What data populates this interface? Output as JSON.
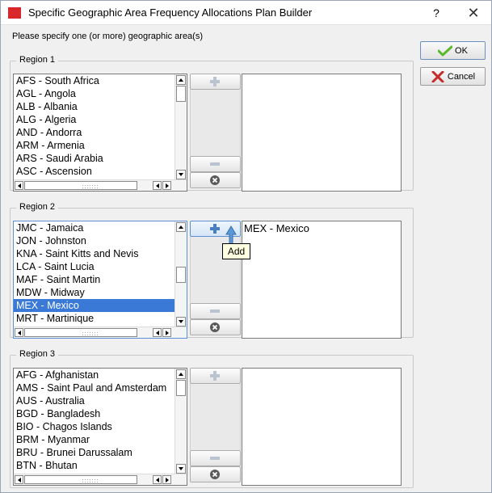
{
  "window": {
    "title": "Specific Geographic Area Frequency Allocations Plan Builder",
    "help_label": "?",
    "close_label": "✕"
  },
  "instruction": "Please specify one (or more) geographic area(s)",
  "buttons": {
    "ok_label": "OK",
    "cancel_label": "Cancel"
  },
  "regions": [
    {
      "label": "Region 1",
      "list": [
        "AFS - South Africa",
        "AGL - Angola",
        "ALB - Albania",
        "ALG - Algeria",
        "AND - Andorra",
        "ARM - Armenia",
        "ARS - Saudi Arabia",
        "ASC - Ascension"
      ],
      "selected_list_item": "",
      "selected_areas": []
    },
    {
      "label": "Region 2",
      "list": [
        "JMC - Jamaica",
        "JON - Johnston",
        "KNA - Saint Kitts and Nevis",
        "LCA - Saint Lucia",
        "MAF - Saint Martin",
        "MDW - Midway",
        "MEX - Mexico",
        "MRT - Martinique"
      ],
      "selected_list_item": "MEX - Mexico",
      "selected_areas": [
        "MEX - Mexico"
      ]
    },
    {
      "label": "Region 3",
      "list": [
        "AFG - Afghanistan",
        "AMS - Saint Paul and Amsterdam",
        "AUS - Australia",
        "BGD - Bangladesh",
        "BIO - Chagos Islands",
        "BRM - Myanmar",
        "BRU - Brunei Darussalam",
        "BTN - Bhutan"
      ],
      "selected_list_item": "",
      "selected_areas": []
    }
  ],
  "tooltip": "Add",
  "icons": {
    "add": "plus-icon",
    "remove": "minus-icon",
    "clear": "clear-x-icon",
    "ok": "checkmark-icon",
    "cancel": "cross-icon"
  },
  "colors": {
    "selection": "#3a7ad6",
    "app_icon": "#d8262b",
    "active_border": "#5b8fd6",
    "tooltip_bg": "#ffffe1",
    "ok_check": "#5bb82a",
    "cancel_cross": "#c62b2b"
  }
}
